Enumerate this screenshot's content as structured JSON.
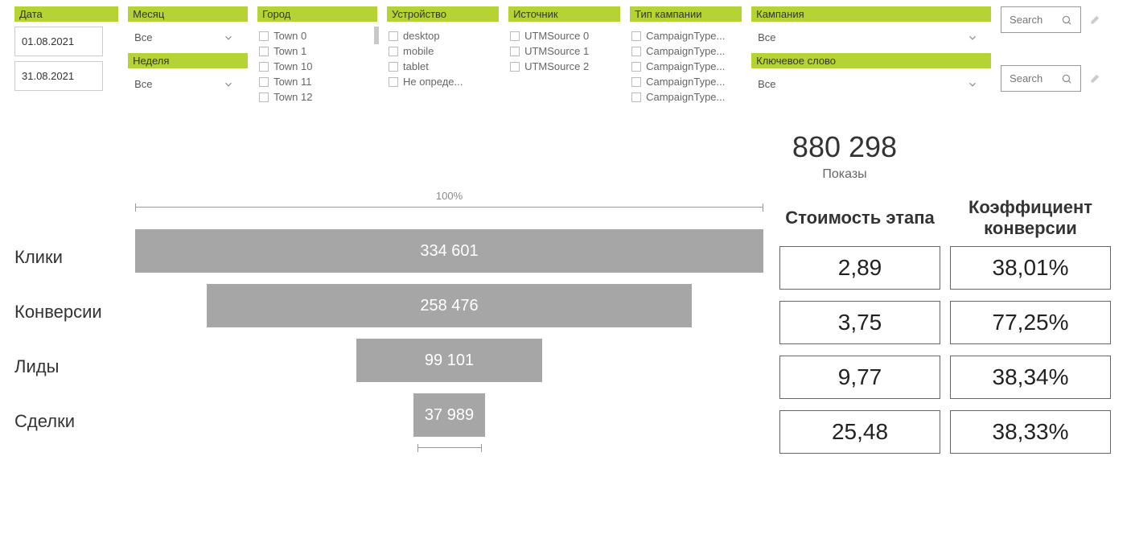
{
  "filters": {
    "date": {
      "label": "Дата",
      "from": "01.08.2021",
      "to": "31.08.2021"
    },
    "month": {
      "label": "Месяц",
      "value": "Все"
    },
    "week": {
      "label": "Неделя",
      "value": "Все"
    },
    "city": {
      "label": "Город",
      "options": [
        "Town 0",
        "Town 1",
        "Town 10",
        "Town 11",
        "Town 12"
      ]
    },
    "device": {
      "label": "Устройство",
      "options": [
        "desktop",
        "mobile",
        "tablet",
        "Не опреде..."
      ]
    },
    "source": {
      "label": "Источник",
      "options": [
        "UTMSource 0",
        "UTMSource 1",
        "UTMSource 2"
      ]
    },
    "campaign_type": {
      "label": "Тип кампании",
      "options": [
        "CampaignType...",
        "CampaignType...",
        "CampaignType...",
        "CampaignType...",
        "CampaignType..."
      ]
    },
    "campaign": {
      "label": "Кампания",
      "value": "Все"
    },
    "keyword": {
      "label": "Ключевое слово",
      "value": "Все"
    },
    "search_placeholder": "Search"
  },
  "kpi": {
    "value": "880 298",
    "label": "Показы"
  },
  "headers": {
    "cost": "Стоимость этапа",
    "conversion": "Коэффициент конверсии"
  },
  "scale_label": "100%",
  "stages": [
    {
      "name": "Клики",
      "value": "334 601",
      "pct": 100,
      "cost": "2,89",
      "conv": "38,01%"
    },
    {
      "name": "Конверсии",
      "value": "258 476",
      "pct": 77.25,
      "cost": "3,75",
      "conv": "77,25%"
    },
    {
      "name": "Лиды",
      "value": "99 101",
      "pct": 29.6,
      "cost": "9,77",
      "conv": "38,34%"
    },
    {
      "name": "Сделки",
      "value": "37 989",
      "pct": 11.35,
      "cost": "25,48",
      "conv": "38,33%"
    }
  ],
  "chart_data": {
    "type": "bar",
    "title": "",
    "orientation": "horizontal-funnel",
    "categories": [
      "Клики",
      "Конверсии",
      "Лиды",
      "Сделки"
    ],
    "values": [
      334601,
      258476,
      99101,
      37989
    ],
    "series": [
      {
        "name": "Стоимость этапа",
        "values": [
          2.89,
          3.75,
          9.77,
          25.48
        ]
      },
      {
        "name": "Коэффициент конверсии (%)",
        "values": [
          38.01,
          77.25,
          38.34,
          38.33
        ]
      }
    ],
    "kpi": {
      "label": "Показы",
      "value": 880298
    },
    "xlabel": "",
    "ylabel": "",
    "scale_pct": 100
  }
}
